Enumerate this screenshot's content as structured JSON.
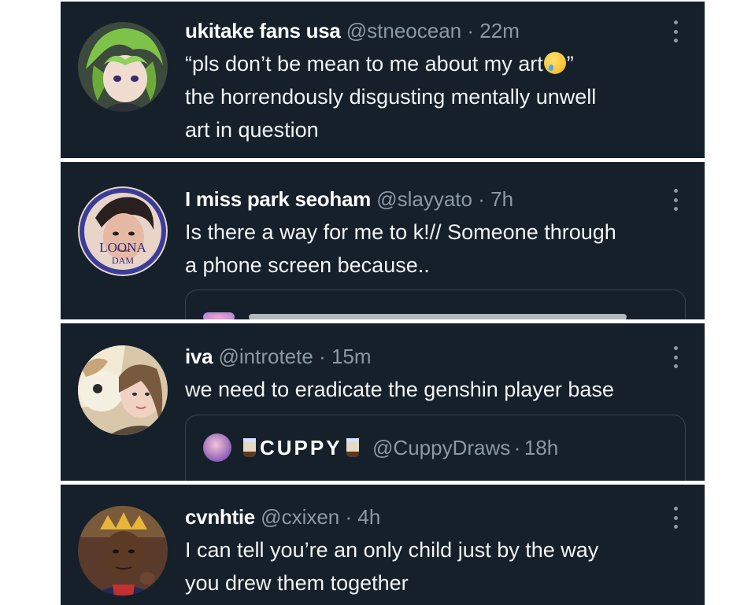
{
  "tweets": [
    {
      "name": "ukitake fans usa",
      "handle": "@stneocean",
      "time": "22m",
      "avatar_icon": "anime-character-avatar-green-hair",
      "text_line1_pre": "“pls don’t be mean to me about my art",
      "text_line1_emoji": "crying-face-emoji",
      "text_line1_post": "”",
      "text_line2": "the horrendously disgusting mentally unwell",
      "text_line3": "art in question"
    },
    {
      "name": "I miss park seoham",
      "handle": "@slayyato",
      "time": "7h",
      "avatar_icon": "person-photo-avatar-loona-frame",
      "avatar_overlay_text": "LOONA",
      "avatar_overlay_text2": "DAM",
      "text_line1": "Is there a way for me to k!// Someone through",
      "text_line2": "a phone screen because.."
    },
    {
      "name": "iva",
      "handle": "@introtete",
      "time": "15m",
      "avatar_icon": "person-with-plush-avatar",
      "text_line1": "we need to eradicate the genshin player base",
      "quote": {
        "name": "CUPPY",
        "handle": "@CuppyDraws",
        "time": "18h",
        "avatar_icon": "cuppy-avatar",
        "emoji_icon": "bubble-tea-emoji"
      }
    },
    {
      "name": "cvnhtie",
      "handle": "@cxixen",
      "time": "4h",
      "avatar_icon": "person-with-crown-avatar",
      "text_line1": "I can tell you’re an only child just by the way",
      "text_line2": "you drew them together"
    }
  ],
  "separator": "·",
  "colors": {
    "background": "#15202b",
    "text": "#ffffff",
    "secondary": "#8b98a5",
    "border": "#38444d"
  }
}
